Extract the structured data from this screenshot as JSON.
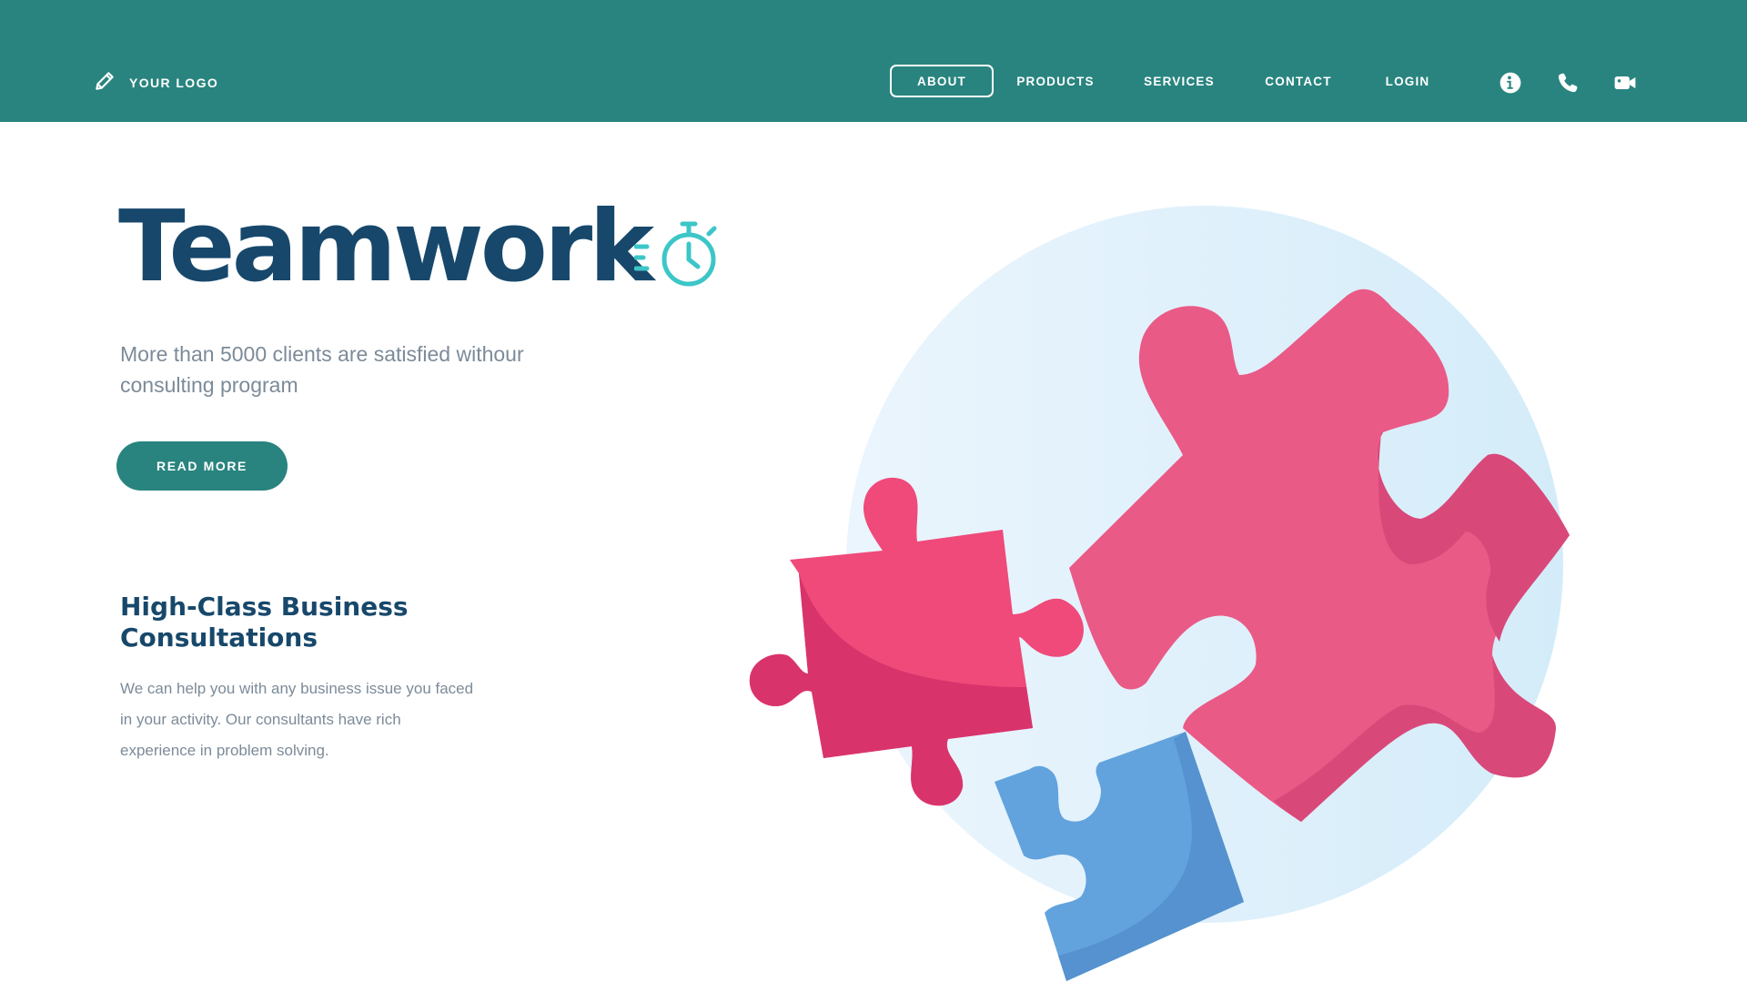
{
  "header": {
    "logo_text": "YOUR LOGO",
    "logo_icon": "pencil-icon",
    "background_color": "#29847f",
    "nav": [
      {
        "label": "ABOUT",
        "active": true
      },
      {
        "label": "PRODUCTS",
        "active": false
      },
      {
        "label": "SERVICES",
        "active": false
      },
      {
        "label": "CONTACT",
        "active": false
      },
      {
        "label": "LOGIN",
        "active": false
      }
    ],
    "icons": [
      "info-icon",
      "phone-icon",
      "video-camera-icon"
    ]
  },
  "hero": {
    "title": "Teamwork",
    "title_icon": "stopwatch-icon",
    "subtitle": "More than 5000 clients are satisfied withour consulting program",
    "button_label": "READ MORE"
  },
  "section": {
    "title": "High-Class Business Consultations",
    "body": "We can help you with any business issue you faced in your activity. Our consultants have rich experience in problem solving."
  },
  "illustration": {
    "name": "puzzle-pieces-illustration",
    "colors": {
      "circle": "#dcf0fb",
      "pink": "#ea5a86",
      "pink_shadow": "#d8497a",
      "red": "#ef4a7a",
      "red_shadow": "#d9336c",
      "blue": "#62a3dd",
      "blue_shadow": "#5592cf",
      "accent_teal": "#3cc6c8",
      "title_navy": "#17486b"
    }
  }
}
